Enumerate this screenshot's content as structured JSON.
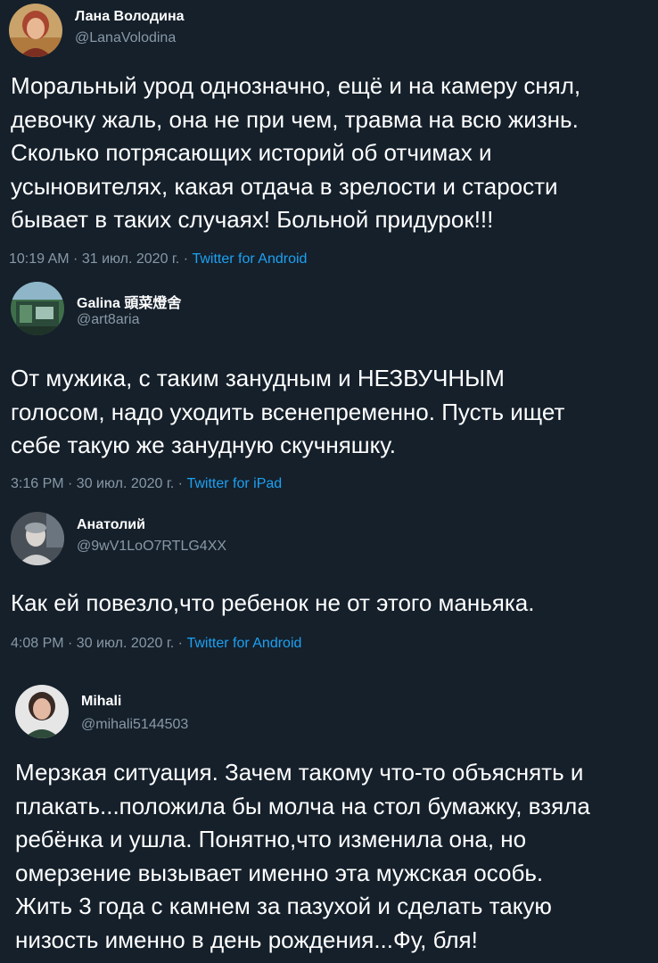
{
  "tweets": [
    {
      "name": "Лана Володина",
      "handle": "@LanaVolodina",
      "text": "Моральный урод однозначно, ещё и на камеру снял,\nдевочку жаль, она не при чем, травма на всю жизнь.\nСколько потрясающих историй об отчимах и\nусыновителях, какая отдача в зрелости и старости\nбывает в таких случаях! Больной придурок!!!",
      "time": "10:19 AM · 31 июл. 2020 г. · ",
      "source": "Twitter for Android"
    },
    {
      "name": "Galina 頭菜燈舍",
      "handle": "@art8aria",
      "text": "От мужика, с таким занудным и НЕЗВУЧНЫМ\nголосом, надо уходить всенепременно. Пусть ищет\nсебе такую же занудную скучняшку.",
      "time": "3:16 PM · 30 июл. 2020 г. · ",
      "source": "Twitter for iPad"
    },
    {
      "name": "Анатолий",
      "handle": "@9wV1LoO7RTLG4XX",
      "text": "Как ей повезло,что ребенок не от этого маньяка.",
      "time": "4:08 PM · 30 июл. 2020 г. · ",
      "source": "Twitter for Android"
    },
    {
      "name": "Mihali",
      "handle": "@mihali5144503",
      "text": "Мерзкая ситуация. Зачем такому что-то объяснять и\nплакать...положила бы молча на стол бумажку, взяла\nребёнка и ушла. Понятно,что изменила она, но\nомерзение вызывает именно эта мужская особь.\nЖить 3 года с камнем за пазухой и сделать такую\nнизость именно в день рождения...Фу, бля!",
      "time": "",
      "source": ""
    }
  ],
  "colors": {
    "background": "#15202b",
    "text": "#ffffff",
    "secondary": "#8899a6",
    "link": "#1da1f2"
  }
}
